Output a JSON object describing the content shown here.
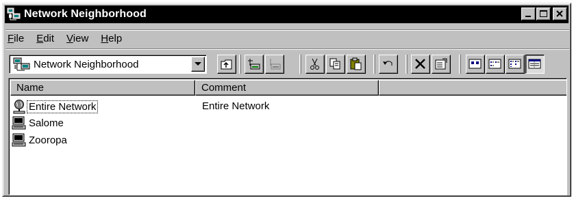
{
  "window": {
    "title": "Network Neighborhood",
    "icon": "network-neighborhood-icon"
  },
  "menu": [
    {
      "label": "File",
      "accel": "F",
      "rest": "ile"
    },
    {
      "label": "Edit",
      "accel": "E",
      "rest": "dit"
    },
    {
      "label": "View",
      "accel": "V",
      "rest": "iew"
    },
    {
      "label": "Help",
      "accel": "H",
      "rest": "elp"
    }
  ],
  "address": {
    "value": "Network Neighborhood",
    "icon": "network-neighborhood-icon"
  },
  "toolbar": [
    "up-one-level-icon",
    "map-network-drive-icon",
    "disconnect-drive-icon",
    "cut-icon",
    "copy-icon",
    "paste-icon",
    "undo-icon",
    "delete-icon",
    "properties-icon",
    "large-icons-icon",
    "small-icons-icon",
    "list-icon",
    "details-icon"
  ],
  "columns": [
    "Name",
    "Comment",
    ""
  ],
  "items": [
    {
      "name": "Entire Network",
      "comment": "Entire Network",
      "icon": "globe-network-icon"
    },
    {
      "name": "Salome",
      "comment": "",
      "icon": "computer-icon"
    },
    {
      "name": "Zooropa",
      "comment": "",
      "icon": "computer-icon"
    }
  ],
  "colors": {
    "face": "#c0c0c0",
    "titlebar": "#000000",
    "highlight": "#ffffff",
    "shadow": "#808080"
  }
}
